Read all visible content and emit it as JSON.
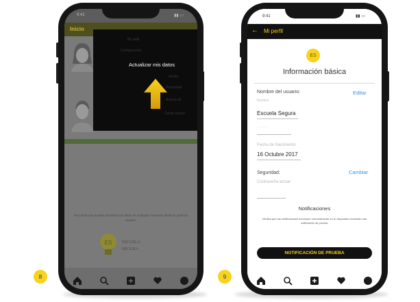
{
  "left_phone": {
    "status_time": "9:41",
    "header_label": "Inicio",
    "menu": {
      "items": [
        "Mi perfil",
        "Configuración",
        "Actualizar mis datos",
        "Ayuda",
        "Privacidad",
        "Acerca de",
        "Cerrar sesión"
      ],
      "highlighted": "Actualizar mis datos"
    },
    "footer_text": "Recuerda que puedes actualizar tus datos en cualquier momento desde tu perfil de usuario.",
    "logo_line1": "ESCUELA",
    "logo_line2": "SEGURA",
    "step_badge": "8"
  },
  "right_phone": {
    "status_time": "9:41",
    "header_title": "Mi perfil",
    "info_icon_text": "ES",
    "section_title": "Información básica",
    "username_label": "Nombre del usuario:",
    "edit_label": "Editar",
    "name_placeholder": "Nombre",
    "name_value": "Escuela Segura",
    "birth_label": "Fecha de Nacimiento",
    "birth_value": "16 Octubre 2017",
    "security_label": "Seguridad:",
    "change_label": "Cambiar",
    "password_label": "Contraseña actual",
    "notifications_title": "Notificaciones",
    "notifications_text": "Verifica que las notificaciones funcionen correctamente en tu dispositivo enviando una notificación de prueba.",
    "test_button": "NOTIFICACIÓN DE PRUEBA",
    "step_badge": "9"
  },
  "colors": {
    "accent_yellow": "#f7d21e",
    "link_blue": "#3a8fd6",
    "header_black": "#111111",
    "overlay_gray": "#7a7a7a",
    "green_bar": "#4f6b3a"
  },
  "icons": [
    "back-arrow-icon",
    "home-icon",
    "search-icon",
    "add-icon",
    "heart-icon",
    "profile-icon",
    "up-arrow-icon",
    "lightbulb-icon"
  ]
}
